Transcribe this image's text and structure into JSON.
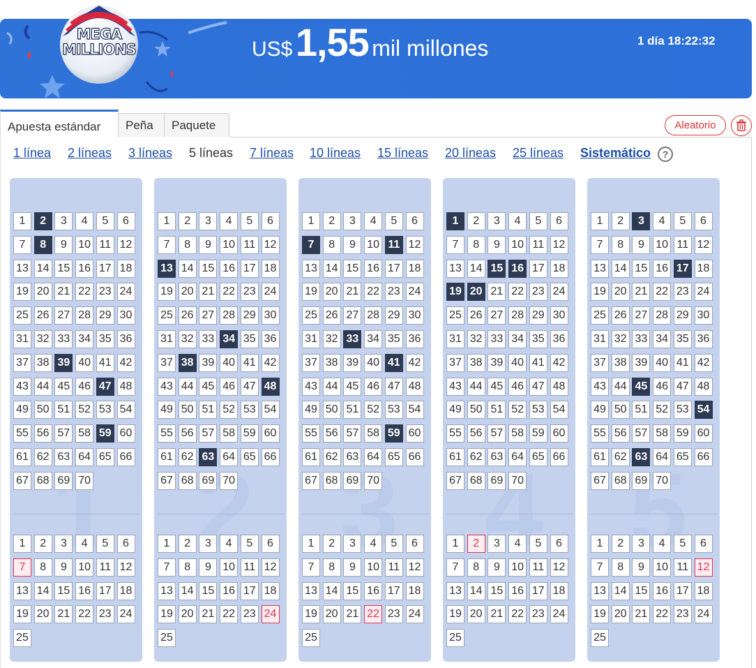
{
  "banner": {
    "logo_line1": "MEGA",
    "logo_line2": "MILLIONS",
    "currency": "US$",
    "amount": "1,55",
    "unit": "mil millones",
    "countdown": "1 día 18:22:32"
  },
  "tabs": [
    "Apuesta estándar",
    "Peña",
    "Paquete"
  ],
  "active_tab": 0,
  "actions": {
    "random_label": "Aleatorio",
    "trash_icon": "trash-icon"
  },
  "lines": {
    "options": [
      "1 línea",
      "2 líneas",
      "3 líneas",
      "5 líneas",
      "7 líneas",
      "10 líneas",
      "15 líneas",
      "20 líneas",
      "25 líneas"
    ],
    "current": "5 líneas",
    "systematic": "Sistemático",
    "help": "?"
  },
  "tickets": [
    {
      "label": "1",
      "main": [
        2,
        8,
        39,
        47,
        59
      ],
      "mega": [
        7
      ]
    },
    {
      "label": "2",
      "main": [
        13,
        34,
        38,
        48,
        63
      ],
      "mega": [
        24
      ]
    },
    {
      "label": "3",
      "main": [
        7,
        11,
        33,
        41,
        59
      ],
      "mega": [
        22
      ]
    },
    {
      "label": "4",
      "main": [
        1,
        15,
        16,
        19,
        20
      ],
      "mega": [
        2
      ]
    },
    {
      "label": "5",
      "main": [
        3,
        17,
        45,
        54,
        63
      ],
      "mega": [
        12
      ]
    }
  ],
  "main_max": 70,
  "mega_max": 25,
  "colors": {
    "banner": "#2f73d9",
    "selected": "#2d3a52",
    "mega_selected": "#e0334f",
    "card": "#c4d2ee",
    "link": "#1f4fa8"
  }
}
